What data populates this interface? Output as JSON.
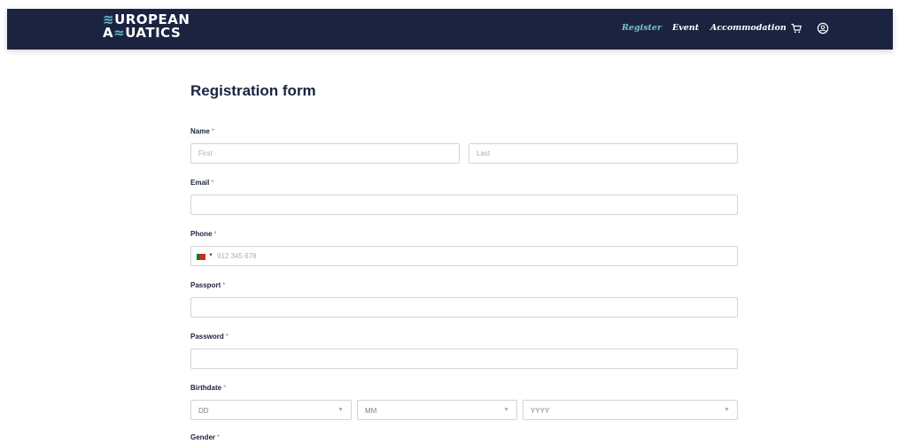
{
  "brand": {
    "line1": "UROPEAN",
    "line2_a": "A",
    "line2_b": "UATICS"
  },
  "nav": {
    "register": "Register",
    "event": "Event",
    "accommodation": "Accommodation"
  },
  "icons": {
    "cart": "cart-icon",
    "account": "account-icon",
    "chevron": "chevron-down-icon",
    "flag": "portugal-flag-icon"
  },
  "colors": {
    "header": "#1c2340",
    "accent": "#7cc1c9",
    "required": "#e06a6a"
  },
  "form": {
    "title": "Registration form",
    "name": {
      "label": "Name",
      "first_placeholder": "First",
      "last_placeholder": "Last"
    },
    "email": {
      "label": "Email"
    },
    "phone": {
      "label": "Phone",
      "placeholder": "912 345 678"
    },
    "passport": {
      "label": "Passport"
    },
    "password": {
      "label": "Password"
    },
    "birthdate": {
      "label": "Birthdate",
      "day": "DD",
      "month": "MM",
      "year": "YYYY"
    },
    "gender": {
      "label": "Gender"
    },
    "required_mark": "*"
  }
}
